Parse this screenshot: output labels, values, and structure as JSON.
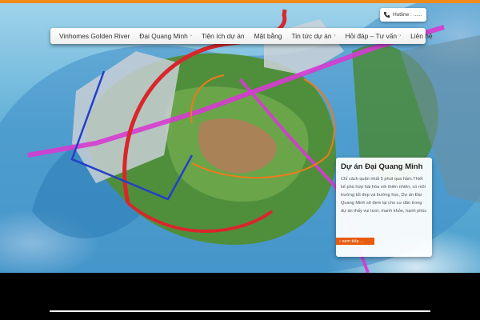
{
  "header": {
    "hotline_label": "Hotline : ......"
  },
  "nav": {
    "items": [
      {
        "label": "Vinhomes Golden River",
        "has_submenu": false
      },
      {
        "label": "Đại Quang Minh",
        "has_submenu": true
      },
      {
        "label": "Tiện ích dự án",
        "has_submenu": false
      },
      {
        "label": "Mặt bằng",
        "has_submenu": false
      },
      {
        "label": "Tin tức dự án",
        "has_submenu": true
      },
      {
        "label": "Hỏi đáp – Tư vấn",
        "has_submenu": true
      },
      {
        "label": "Liên hệ",
        "has_submenu": false
      }
    ]
  },
  "card": {
    "title": "Dự án Đại Quang Minh",
    "body": "Chỉ cách quận nhất 5 phút qua hầm.Thiết kế phù hợp hài hòa với thiên nhiên, có môi trường tốt đẹp và trường học, Dự án Đại Quang Minh sẽ đem lại cho cư dân trong dự án thấy vui tươi, mạnh khỏe, hạnh phúc",
    "more_label": "› xem tiếp ..."
  },
  "icons": {
    "phone": "phone-icon",
    "caret": "chevron-right-icon"
  },
  "colors": {
    "accent": "#f28a1a",
    "button": "#e85a0c",
    "route_red": "#d9262b",
    "route_magenta": "#d63bd0",
    "route_blue": "#2340c8",
    "route_orange": "#ef7a1a"
  }
}
